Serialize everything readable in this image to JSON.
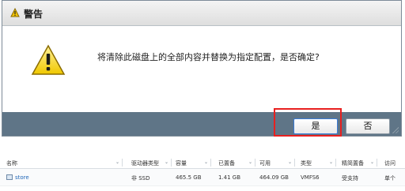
{
  "dialog": {
    "title": "警告",
    "message": "将清除此磁盘上的全部内容并替换为指定配置，是否确定?",
    "yes_label": "是",
    "no_label": "否"
  },
  "table": {
    "headers": [
      "名称",
      "驱动器类型",
      "容量",
      "已置备",
      "可用",
      "类型",
      "精简置备",
      "访问"
    ],
    "rows": [
      {
        "name": "store",
        "drive_type": "非 SSD",
        "capacity": "465.5 GB",
        "provisioned": "1.41 GB",
        "free": "464.09 GB",
        "type": "VMFS6",
        "thin_provisioning": "受支持",
        "access": "单个"
      }
    ]
  },
  "colors": {
    "footer": "#5f7587",
    "highlight": "#e8201f",
    "link": "#1f66b8"
  },
  "icons": [
    "warning-small-icon",
    "warning-icon",
    "chevron-down-icon",
    "datastore-icon"
  ]
}
